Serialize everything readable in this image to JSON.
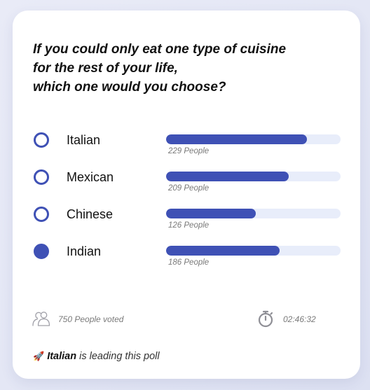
{
  "poll": {
    "question_lines": [
      "If you could only eat one type of cuisine",
      "for the rest of your life,",
      "which one would you choose?"
    ],
    "options": [
      {
        "label": "Italian",
        "count_text": "229 People",
        "percent": 80.6,
        "selected": false
      },
      {
        "label": "Mexican",
        "count_text": "209 People",
        "percent": 70.2,
        "selected": false
      },
      {
        "label": "Chinese",
        "count_text": "126 People",
        "percent": 51.6,
        "selected": false
      },
      {
        "label": "Indian",
        "count_text": "186 People",
        "percent": 64.9,
        "selected": true
      }
    ],
    "total_votes_text": "750 People voted",
    "timer_text": "02:46:32",
    "leading_name": "Italian",
    "leading_suffix": " is leading this poll"
  },
  "icons": {
    "people": "people-icon",
    "stopwatch": "stopwatch-icon",
    "rocket": "rocket-icon"
  },
  "colors": {
    "accent": "#3f51b5",
    "track": "#e8edfa",
    "muted_text": "#7a7a7a"
  }
}
